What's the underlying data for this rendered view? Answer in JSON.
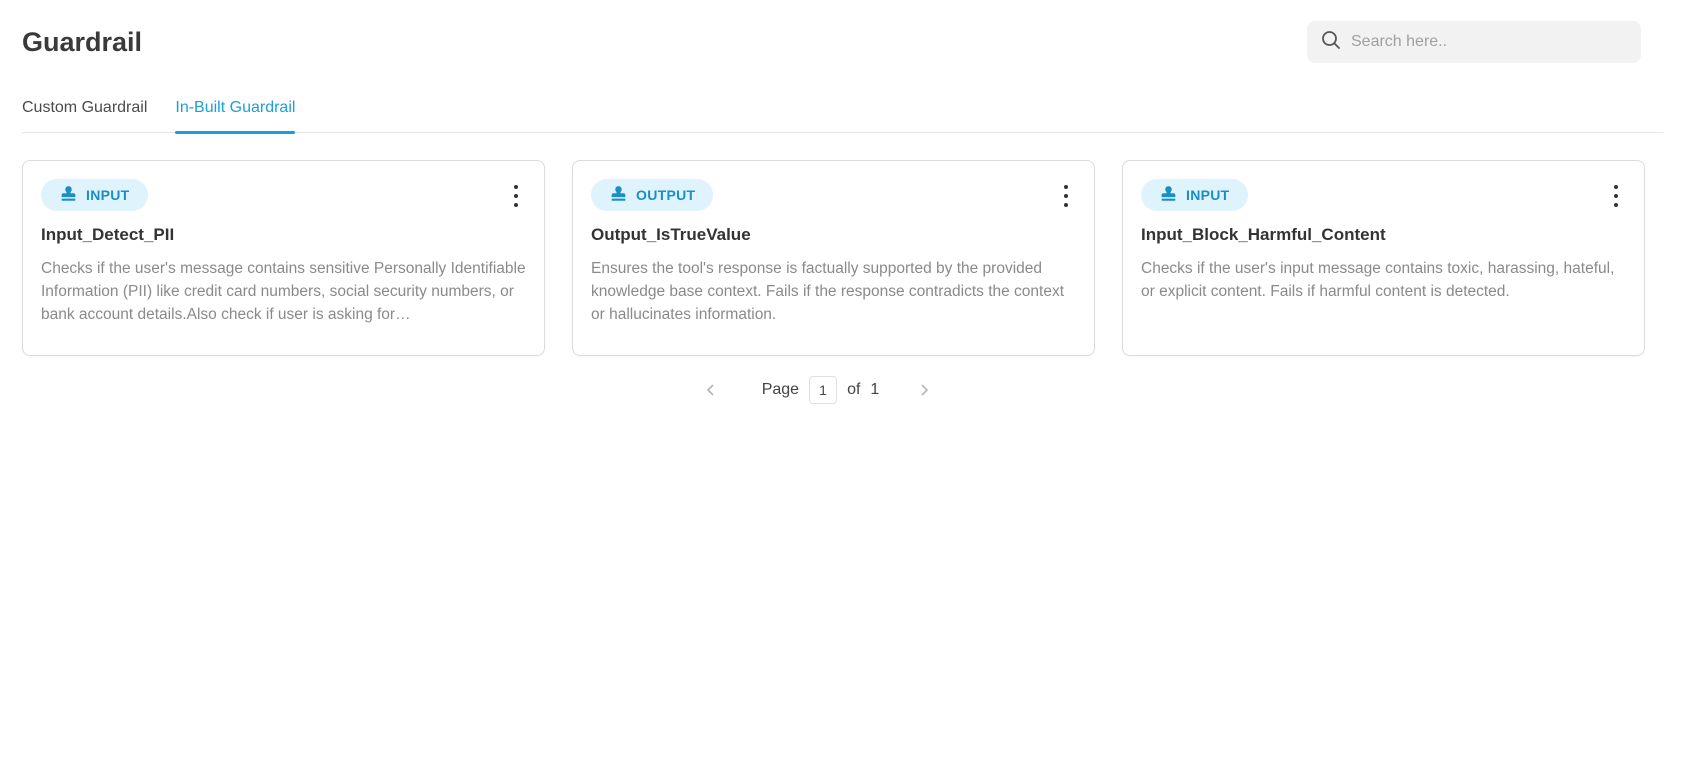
{
  "header": {
    "title": "Guardrail",
    "search_placeholder": "Search here.."
  },
  "tabs": [
    {
      "label": "Custom Guardrail",
      "active": false
    },
    {
      "label": "In-Built Guardrail",
      "active": true
    }
  ],
  "cards": [
    {
      "badge": "INPUT",
      "title": "Input_Detect_PII",
      "description": "Checks if the user's message contains sensitive Personally Identifiable Information (PII) like credit card numbers, social security numbers, or bank account details.Also check if user is asking for…"
    },
    {
      "badge": "OUTPUT",
      "title": "Output_IsTrueValue",
      "description": "Ensures the tool's response is factually supported by the provided knowledge base context. Fails if the response contradicts the context or hallucinates information."
    },
    {
      "badge": "INPUT",
      "title": "Input_Block_Harmful_Content",
      "description": "Checks if the user's input message contains toxic, harassing, hateful, or explicit content. Fails if harmful content is detected."
    }
  ],
  "pagination": {
    "page_label": "Page",
    "current_page": "1",
    "of_label": "of",
    "total_pages": "1"
  },
  "colors": {
    "accent": "#1c9fd6",
    "badge_bg": "#dff3fc"
  },
  "icons": {
    "search": "search-icon",
    "badge": "guardrail-stamp-icon",
    "menu": "kebab-menu-icon",
    "prev": "chevron-left-icon",
    "next": "chevron-right-icon"
  }
}
